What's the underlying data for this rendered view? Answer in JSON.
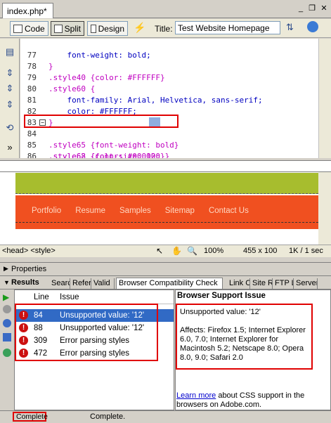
{
  "document": {
    "tab_label": "index.php*"
  },
  "window_controls": {
    "minimize": "_",
    "restore": "❐",
    "close": "✕"
  },
  "toolbar": {
    "code_label": "Code",
    "split_label": "Split",
    "design_label": "Design",
    "title_label": "Title:",
    "title_value": "Test Website Homepage"
  },
  "code": {
    "lines": [
      {
        "num": "77",
        "text": "    font-weight: bold;"
      },
      {
        "num": "78",
        "text": "}"
      },
      {
        "num": "79",
        "text": ".style40 {color: #FFFFFF}"
      },
      {
        "num": "80",
        "text": ".style60 {"
      },
      {
        "num": "81",
        "text": "    font-family: Arial, Helvetica, sans-serif;"
      },
      {
        "num": "82",
        "text": "    color: #FFFFFF;"
      },
      {
        "num": "83",
        "text": "}"
      },
      {
        "num": "84",
        "text": ".style62 {font-size: 12; }"
      },
      {
        "num": "85",
        "text": ".style65 {font-weight: bold}"
      },
      {
        "num": "86",
        "text": ".style68 {color: #000000}"
      }
    ]
  },
  "design": {
    "nav": [
      "Portfolio",
      "Resume",
      "Samples",
      "Sitemap",
      "Contact Us"
    ]
  },
  "tagbar": {
    "tags": "<head> <style>",
    "zoom": "100%",
    "size": "455 x 100",
    "filesize": "1K / 1 sec"
  },
  "properties": {
    "label": "Properties"
  },
  "results": {
    "label": "Results",
    "tabs": [
      "Searc",
      "Refer",
      "Valid",
      "Browser Compatibility Check",
      "Link C",
      "Site R",
      "FTP L",
      "Server"
    ],
    "columns": {
      "line": "Line",
      "issue": "Issue"
    },
    "rows": [
      {
        "line": "84",
        "issue": "Unsupported value: '12'"
      },
      {
        "line": "88",
        "issue": "Unsupported value: '12'"
      },
      {
        "line": "309",
        "issue": "Error parsing styles"
      },
      {
        "line": "472",
        "issue": "Error parsing styles"
      }
    ]
  },
  "browser_support": {
    "title": "Browser Support Issue",
    "issue": "Unsupported value: '12'",
    "affects": "Affects: Firefox 1.5; Internet Explorer 6.0, 7.0; Internet Explorer for Macintosh 5.2; Netscape 8.0; Opera 8.0, 9.0; Safari 2.0",
    "link_text": "Learn more",
    "foot_text": " about CSS support in the browsers on Adobe.com."
  },
  "status": {
    "left": "Complete",
    "right": "Complete."
  },
  "colors": {
    "highlight_red": "#e00000",
    "green_band": "#a7bd2e",
    "orange_band": "#f05020",
    "selection_blue": "#316ac5"
  }
}
